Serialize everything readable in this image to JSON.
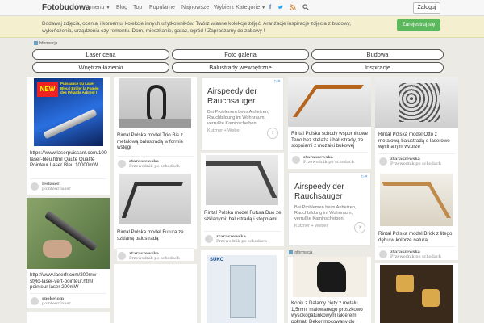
{
  "header": {
    "logo": "Fotobudowa",
    "nav": [
      {
        "label": "menu"
      },
      {
        "label": "Blog"
      },
      {
        "label": "Top"
      },
      {
        "label": "Popularne"
      },
      {
        "label": "Najnowsze"
      },
      {
        "label": "Wybierz Kategorie"
      }
    ],
    "login": "Zaloguj"
  },
  "banner": {
    "text": "Dodawaj zdjęcia, oceniaj i komentuj kolekcje innych użytkowników. Twórz własne kolekcje zdjęć. Aranżacje inspiracje zdjęcia z budowy, wykończenia, urządzenia czy remontu. Dom, mieszkanie, garaż, ogród ! Zapraszamy do zabawy !",
    "register": "Zarejestruj się"
  },
  "info_label": "Informacja",
  "categories": [
    "Laser cena",
    "Foto galeria",
    "Budowa",
    "Wnętrza łazienki",
    "Balustrady wewnętrzne",
    "Inspiracje"
  ],
  "cards": [
    {
      "text": "https://www.laserpuissant.com/10000mw-laser-bleu.html Qaute Qualité Pointeur Laser Bleu 10000mW",
      "user": "leslaser",
      "guide": "pointeur laser",
      "img_text": "Puissance du Laser Bleu / Brûler la Fumée des Pétards Arbrest !"
    },
    {
      "text": "http://www.laserfr.com/200mw-stylo-laser-vert-pointeur.html pointeur laser 200mW",
      "user": "spoketom",
      "guide": "pointeur laser"
    },
    {
      "text": "Rintal Polska model Trio Bis z metalową balustradą w formie wstęgi",
      "user": "ztaraszewska",
      "guide": "Przewodnik po schodach"
    },
    {
      "text": "Rintal Polska model Futura ze szklaną balustradą",
      "user": "ztaraszewska",
      "guide": "Przewodnik po schodach"
    },
    {
      "text": "Rintal Polska model Futura Duo ze szklanymi: balustradą i stopniami",
      "user": "ztaraszewska",
      "guide": "Przewodnik po schodach"
    },
    {
      "text": "Rintal Polska schody wspornikowe Teno bez stelaża i balustrady, ze stopniami z mozaiki bukowej",
      "user": "ztaraszewska",
      "guide": "Przewodnik po schodach"
    },
    {
      "text": "Konik z Dalamy cięty z metalu 1,5mm, malowanego proszkowo wysokogatunkowym lakierem, połmat. Dekor mocowany do",
      "user": "",
      "guide": ""
    },
    {
      "text": "Rintal Polska model Otto z metalową balustradą o laserowo wycinanym wzorze",
      "user": "ztaraszewska",
      "guide": "Przewodnik po schodach"
    },
    {
      "text": "Rintal Polska model Brick z litego dębu w kolorze natura",
      "user": "ztaraszewska",
      "guide": "Przewodnik po schodach"
    }
  ],
  "ads": [
    {
      "title": "Airspeedy der Rauchsauger",
      "body": "Bei Problemen beim Anheizen, Rauchbildung im Wohnraum, verrußte Kaminscheiben!",
      "source": "Kutzner + Weber",
      "mark": "▷✕",
      "arrow": "›"
    },
    {
      "title": "Airspeedy der Rauchsauger",
      "body": "Bei Problemen beim Anheizen, Rauchbildung im Wohnraum, verrußte Kaminscheiben!",
      "source": "Kutzner + Weber",
      "mark": "▷✕",
      "arrow": "›"
    }
  ],
  "suko_label": "SUKO",
  "colors": {
    "accent_green": "#5cb85c",
    "banner_bg": "#f4f0cf",
    "page_bg": "#eceae4"
  }
}
